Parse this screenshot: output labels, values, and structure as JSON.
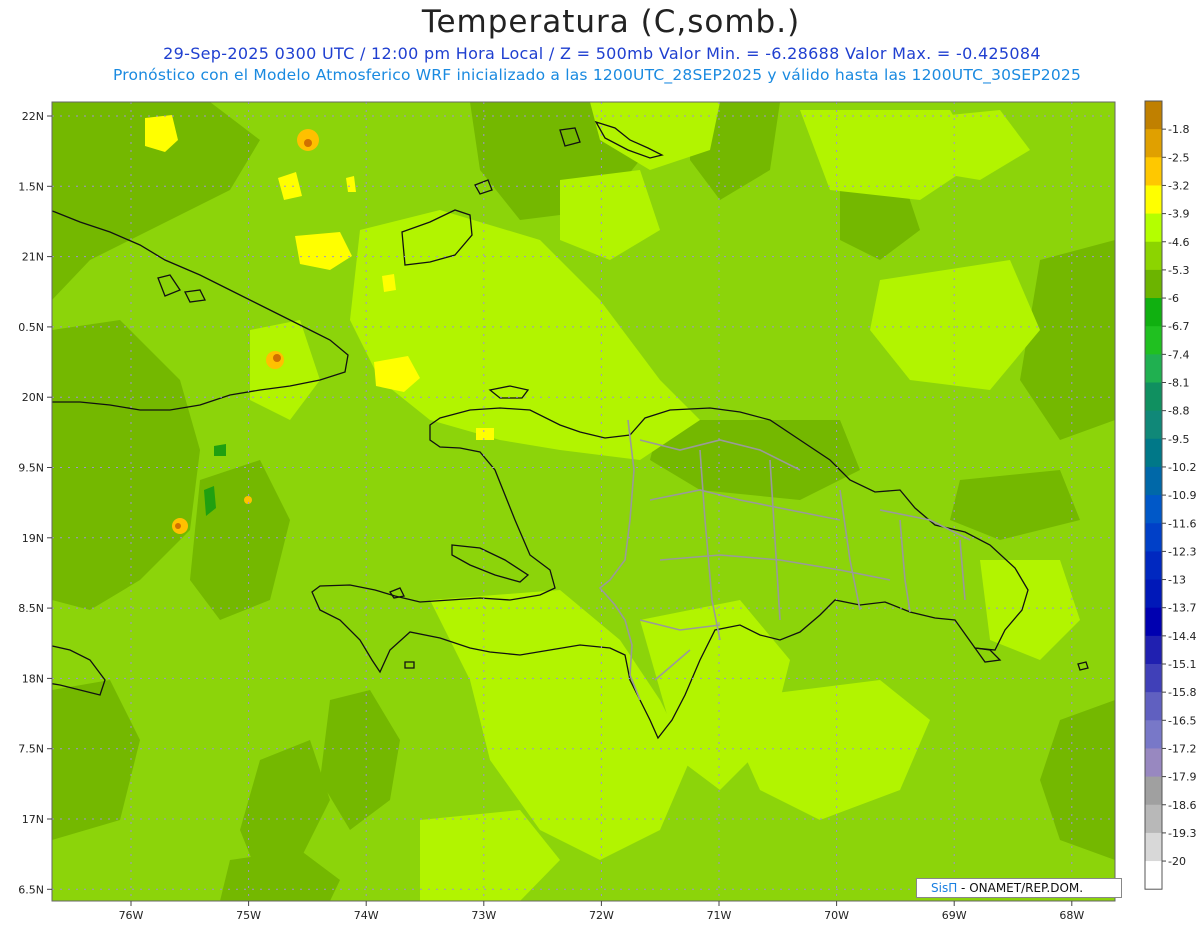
{
  "header": {
    "title": "Temperatura (C,somb.)",
    "subtitle": "29-Sep-2025 0300 UTC / 12:00 pm Hora Local / Z = 500mb Valor Min. = -6.28688  Valor Max. = -0.425084",
    "model_info": "Pronóstico con el Modelo Atmosferico WRF inicializado a las 1200UTC_28SEP2025 y válido hasta las  1200UTC_30SEP2025"
  },
  "credit": {
    "brand": "SisΠ",
    "text": " - ONAMET/REP.DOM."
  },
  "map": {
    "lon_range": [
      -76.6,
      -67.6
    ],
    "lat_range": [
      16.4,
      22.1
    ],
    "lon_ticks": [
      "76W",
      "75W",
      "74W",
      "73W",
      "72W",
      "71W",
      "70W",
      "69W",
      "68W"
    ],
    "lat_ticks": [
      "22N",
      "1.5N",
      "21N",
      "0.5N",
      "20N",
      "9.5N",
      "19N",
      "8.5N",
      "18N",
      "7.5N",
      "17N",
      "6.5N"
    ],
    "base_color": "#8cd40a",
    "grid": "dotted",
    "regions": [
      "Cuba",
      "Bahamas",
      "Haiti",
      "Dominican Republic",
      "Jamaica",
      "Puerto Rico"
    ]
  },
  "colorbar": {
    "levels": [
      "-1.8",
      "-2.5",
      "-3.2",
      "-3.9",
      "-4.6",
      "-5.3",
      "-6",
      "-6.7",
      "-7.4",
      "-8.1",
      "-8.8",
      "-9.5",
      "-10.2",
      "-10.9",
      "-11.6",
      "-12.3",
      "-13",
      "-13.7",
      "-14.4",
      "-15.1",
      "-15.8",
      "-16.5",
      "-17.2",
      "-17.9",
      "-18.6",
      "-19.3",
      "-20"
    ],
    "colors": [
      "#c08000",
      "#e0a000",
      "#ffc800",
      "#ffff00",
      "#b4ff00",
      "#8cd400",
      "#6cb400",
      "#10b010",
      "#20c020",
      "#20b050",
      "#109060",
      "#108878",
      "#007888",
      "#0068a8",
      "#0058c8",
      "#0040c8",
      "#0028c0",
      "#0018b8",
      "#0000b0",
      "#2020b0",
      "#4040b8",
      "#6060c0",
      "#7878c8",
      "#9888c0",
      "#a0a0a0",
      "#b8b8b8",
      "#d8d8d8",
      "#ffffff"
    ]
  }
}
